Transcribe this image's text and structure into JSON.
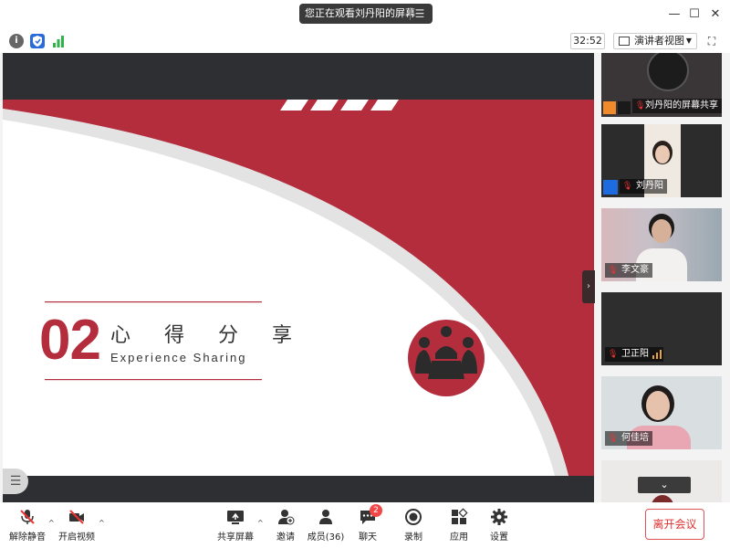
{
  "titlebar": {
    "viewing_text": "您正在观看刘丹阳的屏幕",
    "menu_icon": "menu-lines-icon",
    "window_buttons": [
      "minimize-icon",
      "maximize-icon",
      "close-icon"
    ]
  },
  "infobar": {
    "timer": "32:52",
    "view_mode": "演讲者视图"
  },
  "slide": {
    "number": "02",
    "title_zh": "心 得 分 享",
    "title_en": "Experience Sharing"
  },
  "participants": [
    {
      "name": "刘丹阳的屏幕共享"
    },
    {
      "name": "刘丹阳"
    },
    {
      "name": "李文豪"
    },
    {
      "name": "卫正阳"
    },
    {
      "name": "何佳培"
    }
  ],
  "toolbar": {
    "unmute": "解除静音",
    "start_video": "开启视频",
    "share_screen": "共享屏幕",
    "invite": "邀请",
    "members": "成员(36)",
    "chat": "聊天",
    "chat_badge": "2",
    "record": "录制",
    "apps": "应用",
    "settings": "设置",
    "leave": "离开会议"
  },
  "colors": {
    "slide_red": "#b32d3d",
    "leave_red": "#e02e2e",
    "dark_bg": "#2d2f33"
  }
}
